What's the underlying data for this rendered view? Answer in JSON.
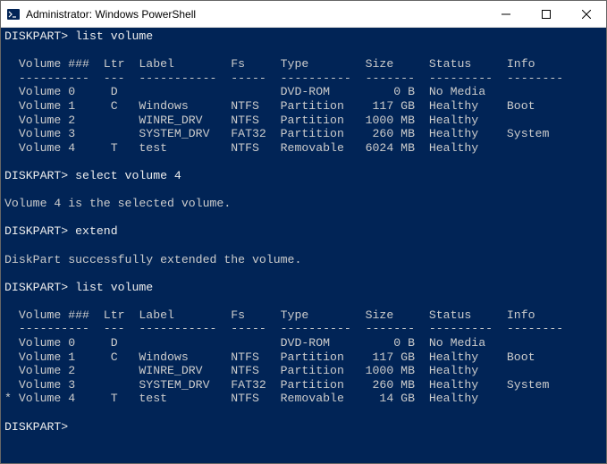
{
  "window": {
    "title": "Administrator: Windows PowerShell"
  },
  "term": {
    "p1": "DISKPART> ",
    "c1": "list volume",
    "hdr1": "  Volume ###  Ltr  Label        Fs     Type        Size     Status     Info",
    "sep1": "  ----------  ---  -----------  -----  ----------  -------  ---------  --------",
    "v1_0": "  Volume 0     D                       DVD-ROM         0 B  No Media",
    "v1_1": "  Volume 1     C   Windows      NTFS   Partition    117 GB  Healthy    Boot",
    "v1_2": "  Volume 2         WINRE_DRV    NTFS   Partition   1000 MB  Healthy",
    "v1_3": "  Volume 3         SYSTEM_DRV   FAT32  Partition    260 MB  Healthy    System",
    "v1_4": "  Volume 4     T   test         NTFS   Removable   6024 MB  Healthy",
    "p2": "DISKPART> ",
    "c2": "select volume 4",
    "m2": "Volume 4 is the selected volume.",
    "p3": "DISKPART> ",
    "c3": "extend",
    "m3": "DiskPart successfully extended the volume.",
    "p4": "DISKPART> ",
    "c4": "list volume",
    "hdr2": "  Volume ###  Ltr  Label        Fs     Type        Size     Status     Info",
    "sep2": "  ----------  ---  -----------  -----  ----------  -------  ---------  --------",
    "v2_0": "  Volume 0     D                       DVD-ROM         0 B  No Media",
    "v2_1": "  Volume 1     C   Windows      NTFS   Partition    117 GB  Healthy    Boot",
    "v2_2": "  Volume 2         WINRE_DRV    NTFS   Partition   1000 MB  Healthy",
    "v2_3": "  Volume 3         SYSTEM_DRV   FAT32  Partition    260 MB  Healthy    System",
    "v2_4": "* Volume 4     T   test         NTFS   Removable     14 GB  Healthy",
    "p5": "DISKPART>"
  },
  "chart_data": {
    "type": "table",
    "note": "Two listings of volumes before and after extend on Volume 4",
    "listings": [
      {
        "context": "before extend",
        "columns": [
          "Volume ###",
          "Ltr",
          "Label",
          "Fs",
          "Type",
          "Size",
          "Status",
          "Info"
        ],
        "rows": [
          [
            "Volume 0",
            "D",
            "",
            "",
            "DVD-ROM",
            "0 B",
            "No Media",
            ""
          ],
          [
            "Volume 1",
            "C",
            "Windows",
            "NTFS",
            "Partition",
            "117 GB",
            "Healthy",
            "Boot"
          ],
          [
            "Volume 2",
            "",
            "WINRE_DRV",
            "NTFS",
            "Partition",
            "1000 MB",
            "Healthy",
            ""
          ],
          [
            "Volume 3",
            "",
            "SYSTEM_DRV",
            "FAT32",
            "Partition",
            "260 MB",
            "Healthy",
            "System"
          ],
          [
            "Volume 4",
            "T",
            "test",
            "NTFS",
            "Removable",
            "6024 MB",
            "Healthy",
            ""
          ]
        ]
      },
      {
        "context": "after extend",
        "columns": [
          "Volume ###",
          "Ltr",
          "Label",
          "Fs",
          "Type",
          "Size",
          "Status",
          "Info"
        ],
        "rows": [
          [
            "Volume 0",
            "D",
            "",
            "",
            "DVD-ROM",
            "0 B",
            "No Media",
            ""
          ],
          [
            "Volume 1",
            "C",
            "Windows",
            "NTFS",
            "Partition",
            "117 GB",
            "Healthy",
            "Boot"
          ],
          [
            "Volume 2",
            "",
            "WINRE_DRV",
            "NTFS",
            "Partition",
            "1000 MB",
            "Healthy",
            ""
          ],
          [
            "Volume 3",
            "",
            "SYSTEM_DRV",
            "FAT32",
            "Partition",
            "260 MB",
            "Healthy",
            "System"
          ],
          [
            "Volume 4",
            "T",
            "test",
            "NTFS",
            "Removable",
            "14 GB",
            "Healthy",
            ""
          ]
        ],
        "selected_row_index": 4
      }
    ]
  }
}
